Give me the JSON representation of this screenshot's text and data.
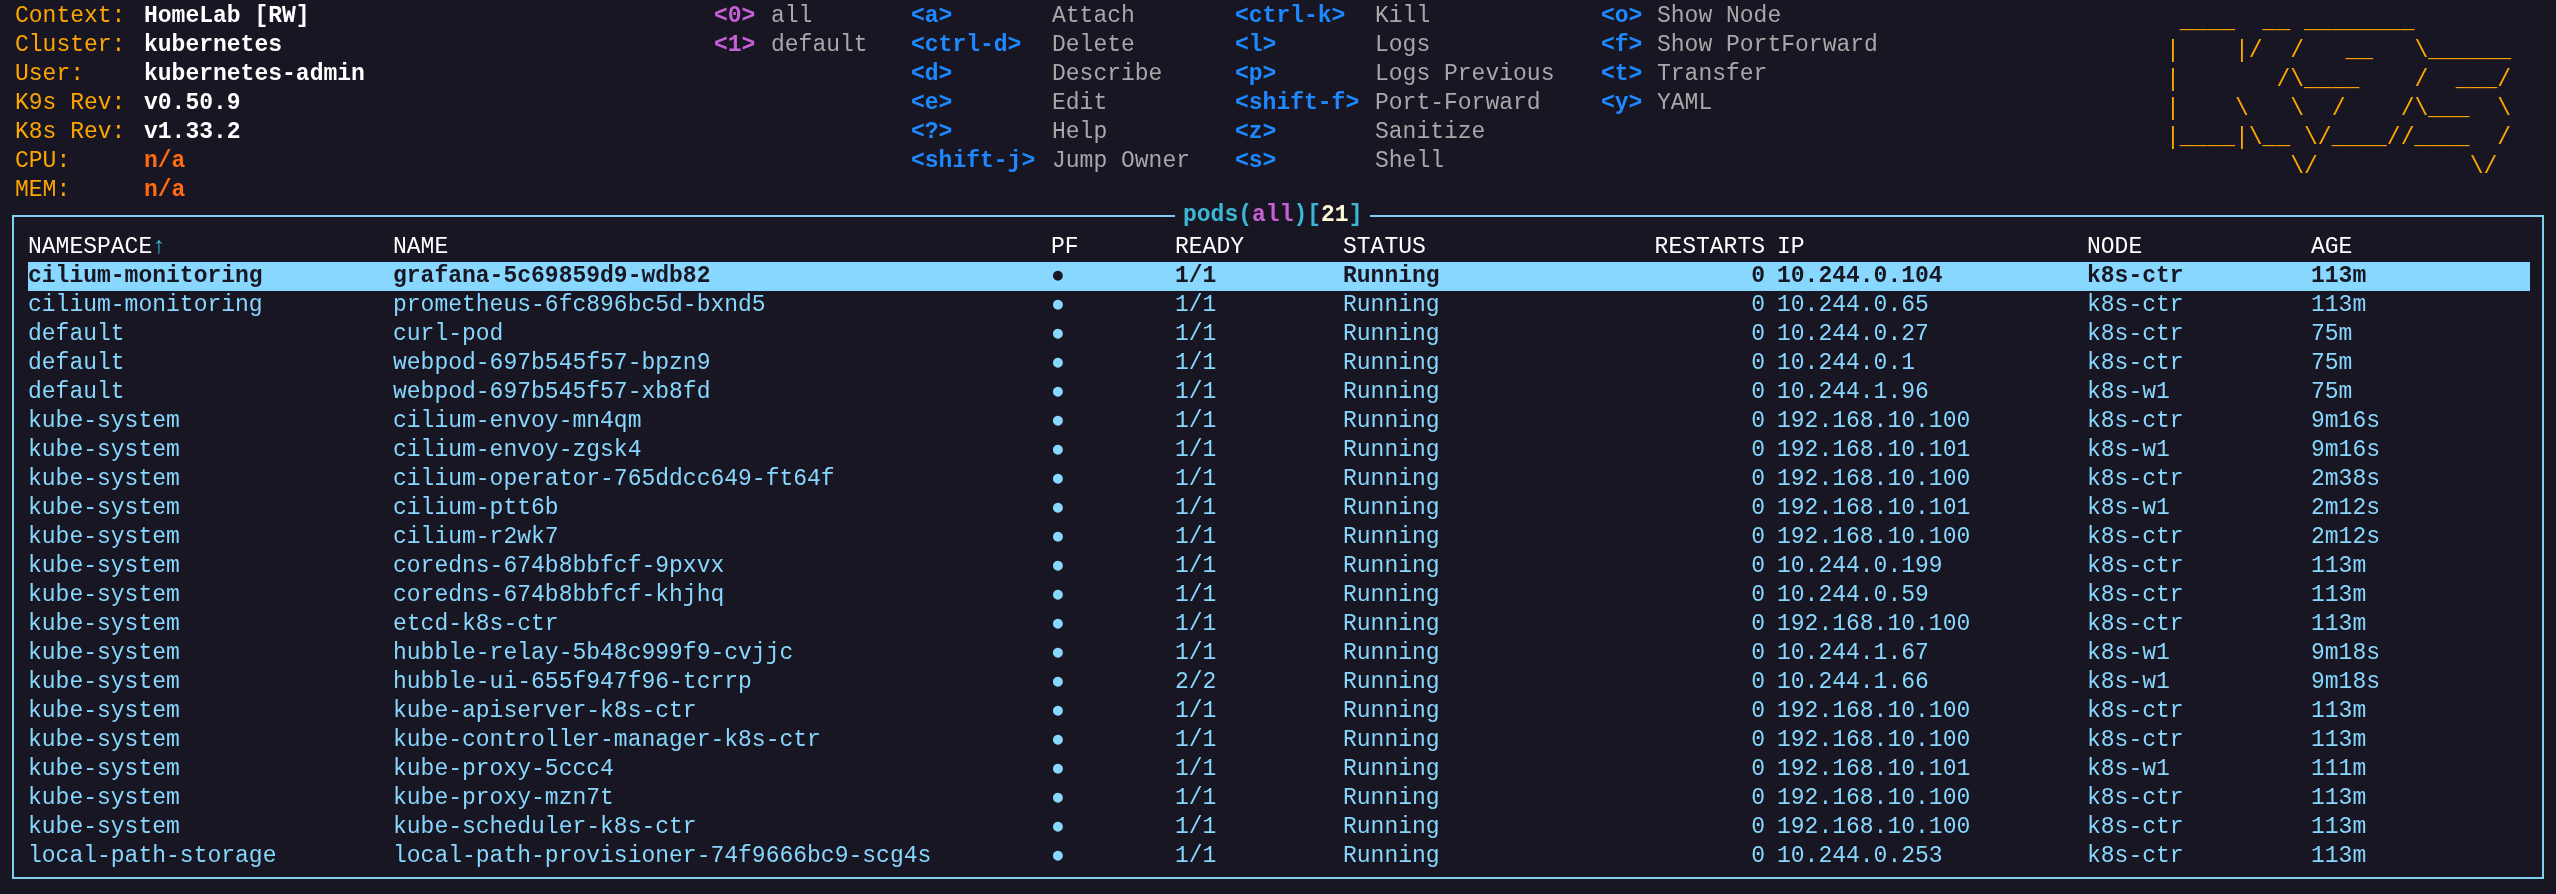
{
  "info": [
    {
      "label": "Context:",
      "value": "HomeLab [RW]",
      "kind": "normal"
    },
    {
      "label": "Cluster:",
      "value": "kubernetes",
      "kind": "normal"
    },
    {
      "label": "User:",
      "value": "kubernetes-admin",
      "kind": "normal"
    },
    {
      "label": "K9s Rev:",
      "value": "v0.50.9",
      "kind": "normal"
    },
    {
      "label": "K8s Rev:",
      "value": "v1.33.2",
      "kind": "normal"
    },
    {
      "label": "CPU:",
      "value": "n/a",
      "kind": "warn"
    },
    {
      "label": "MEM:",
      "value": "n/a",
      "kind": "warn"
    }
  ],
  "namespaces": [
    {
      "key": "<0>",
      "label": "all"
    },
    {
      "key": "<1>",
      "label": "default"
    }
  ],
  "keybind_columns": [
    [
      {
        "key": "<a>",
        "label": "Attach"
      },
      {
        "key": "<ctrl-d>",
        "label": "Delete"
      },
      {
        "key": "<d>",
        "label": "Describe"
      },
      {
        "key": "<e>",
        "label": "Edit"
      },
      {
        "key": "<?>",
        "label": "Help"
      },
      {
        "key": "<shift-j>",
        "label": "Jump Owner"
      }
    ],
    [
      {
        "key": "<ctrl-k>",
        "label": "Kill"
      },
      {
        "key": "<l>",
        "label": "Logs"
      },
      {
        "key": "<p>",
        "label": "Logs Previous"
      },
      {
        "key": "<shift-f>",
        "label": "Port-Forward"
      },
      {
        "key": "<z>",
        "label": "Sanitize"
      },
      {
        "key": "<s>",
        "label": "Shell"
      }
    ],
    [
      {
        "key": "<o>",
        "label": "Show Node"
      },
      {
        "key": "<f>",
        "label": "Show PortForward"
      },
      {
        "key": "<t>",
        "label": "Transfer"
      },
      {
        "key": "<y>",
        "label": "YAML"
      }
    ]
  ],
  "logo": [
    " ____  __ ________       ",
    "|    |/  /   __   \\______",
    "|       /\\____    /  ___/",
    "|    \\   \\  /    /\\___  \\",
    "|____|\\__ \\/____//____  /",
    "         \\/           \\/ "
  ],
  "table": {
    "title": [
      {
        "text": "pods",
        "kind": "resource"
      },
      {
        "text": "(",
        "kind": "punct"
      },
      {
        "text": "all",
        "kind": "scope"
      },
      {
        "text": ")[",
        "kind": "punct"
      },
      {
        "text": "21",
        "kind": "count"
      },
      {
        "text": "]",
        "kind": "punct"
      }
    ],
    "columns": [
      {
        "label": "NAMESPACE",
        "sort_marker": "↑"
      },
      {
        "label": "NAME"
      },
      {
        "label": "PF"
      },
      {
        "label": "READY"
      },
      {
        "label": "STATUS"
      },
      {
        "label": "RESTARTS"
      },
      {
        "label": "IP"
      },
      {
        "label": "NODE"
      },
      {
        "label": "AGE"
      }
    ],
    "rows": [
      {
        "selected": true,
        "cells": [
          "cilium-monitoring",
          "grafana-5c69859d9-wdb82",
          "●",
          "1/1",
          "Running",
          "0",
          "10.244.0.104",
          "k8s-ctr",
          "113m"
        ]
      },
      {
        "selected": false,
        "cells": [
          "cilium-monitoring",
          "prometheus-6fc896bc5d-bxnd5",
          "●",
          "1/1",
          "Running",
          "0",
          "10.244.0.65",
          "k8s-ctr",
          "113m"
        ]
      },
      {
        "selected": false,
        "cells": [
          "default",
          "curl-pod",
          "●",
          "1/1",
          "Running",
          "0",
          "10.244.0.27",
          "k8s-ctr",
          "75m"
        ]
      },
      {
        "selected": false,
        "cells": [
          "default",
          "webpod-697b545f57-bpzn9",
          "●",
          "1/1",
          "Running",
          "0",
          "10.244.0.1",
          "k8s-ctr",
          "75m"
        ]
      },
      {
        "selected": false,
        "cells": [
          "default",
          "webpod-697b545f57-xb8fd",
          "●",
          "1/1",
          "Running",
          "0",
          "10.244.1.96",
          "k8s-w1",
          "75m"
        ]
      },
      {
        "selected": false,
        "cells": [
          "kube-system",
          "cilium-envoy-mn4qm",
          "●",
          "1/1",
          "Running",
          "0",
          "192.168.10.100",
          "k8s-ctr",
          "9m16s"
        ]
      },
      {
        "selected": false,
        "cells": [
          "kube-system",
          "cilium-envoy-zgsk4",
          "●",
          "1/1",
          "Running",
          "0",
          "192.168.10.101",
          "k8s-w1",
          "9m16s"
        ]
      },
      {
        "selected": false,
        "cells": [
          "kube-system",
          "cilium-operator-765ddcc649-ft64f",
          "●",
          "1/1",
          "Running",
          "0",
          "192.168.10.100",
          "k8s-ctr",
          "2m38s"
        ]
      },
      {
        "selected": false,
        "cells": [
          "kube-system",
          "cilium-ptt6b",
          "●",
          "1/1",
          "Running",
          "0",
          "192.168.10.101",
          "k8s-w1",
          "2m12s"
        ]
      },
      {
        "selected": false,
        "cells": [
          "kube-system",
          "cilium-r2wk7",
          "●",
          "1/1",
          "Running",
          "0",
          "192.168.10.100",
          "k8s-ctr",
          "2m12s"
        ]
      },
      {
        "selected": false,
        "cells": [
          "kube-system",
          "coredns-674b8bbfcf-9pxvx",
          "●",
          "1/1",
          "Running",
          "0",
          "10.244.0.199",
          "k8s-ctr",
          "113m"
        ]
      },
      {
        "selected": false,
        "cells": [
          "kube-system",
          "coredns-674b8bbfcf-khjhq",
          "●",
          "1/1",
          "Running",
          "0",
          "10.244.0.59",
          "k8s-ctr",
          "113m"
        ]
      },
      {
        "selected": false,
        "cells": [
          "kube-system",
          "etcd-k8s-ctr",
          "●",
          "1/1",
          "Running",
          "0",
          "192.168.10.100",
          "k8s-ctr",
          "113m"
        ]
      },
      {
        "selected": false,
        "cells": [
          "kube-system",
          "hubble-relay-5b48c999f9-cvjjc",
          "●",
          "1/1",
          "Running",
          "0",
          "10.244.1.67",
          "k8s-w1",
          "9m18s"
        ]
      },
      {
        "selected": false,
        "cells": [
          "kube-system",
          "hubble-ui-655f947f96-tcrrp",
          "●",
          "2/2",
          "Running",
          "0",
          "10.244.1.66",
          "k8s-w1",
          "9m18s"
        ]
      },
      {
        "selected": false,
        "cells": [
          "kube-system",
          "kube-apiserver-k8s-ctr",
          "●",
          "1/1",
          "Running",
          "0",
          "192.168.10.100",
          "k8s-ctr",
          "113m"
        ]
      },
      {
        "selected": false,
        "cells": [
          "kube-system",
          "kube-controller-manager-k8s-ctr",
          "●",
          "1/1",
          "Running",
          "0",
          "192.168.10.100",
          "k8s-ctr",
          "113m"
        ]
      },
      {
        "selected": false,
        "cells": [
          "kube-system",
          "kube-proxy-5ccc4",
          "●",
          "1/1",
          "Running",
          "0",
          "192.168.10.101",
          "k8s-w1",
          "111m"
        ]
      },
      {
        "selected": false,
        "cells": [
          "kube-system",
          "kube-proxy-mzn7t",
          "●",
          "1/1",
          "Running",
          "0",
          "192.168.10.100",
          "k8s-ctr",
          "113m"
        ]
      },
      {
        "selected": false,
        "cells": [
          "kube-system",
          "kube-scheduler-k8s-ctr",
          "●",
          "1/1",
          "Running",
          "0",
          "192.168.10.100",
          "k8s-ctr",
          "113m"
        ]
      },
      {
        "selected": false,
        "cells": [
          "local-path-storage",
          "local-path-provisioner-74f9666bc9-scg4s",
          "●",
          "1/1",
          "Running",
          "0",
          "10.244.0.253",
          "k8s-ctr",
          "113m"
        ]
      }
    ]
  }
}
